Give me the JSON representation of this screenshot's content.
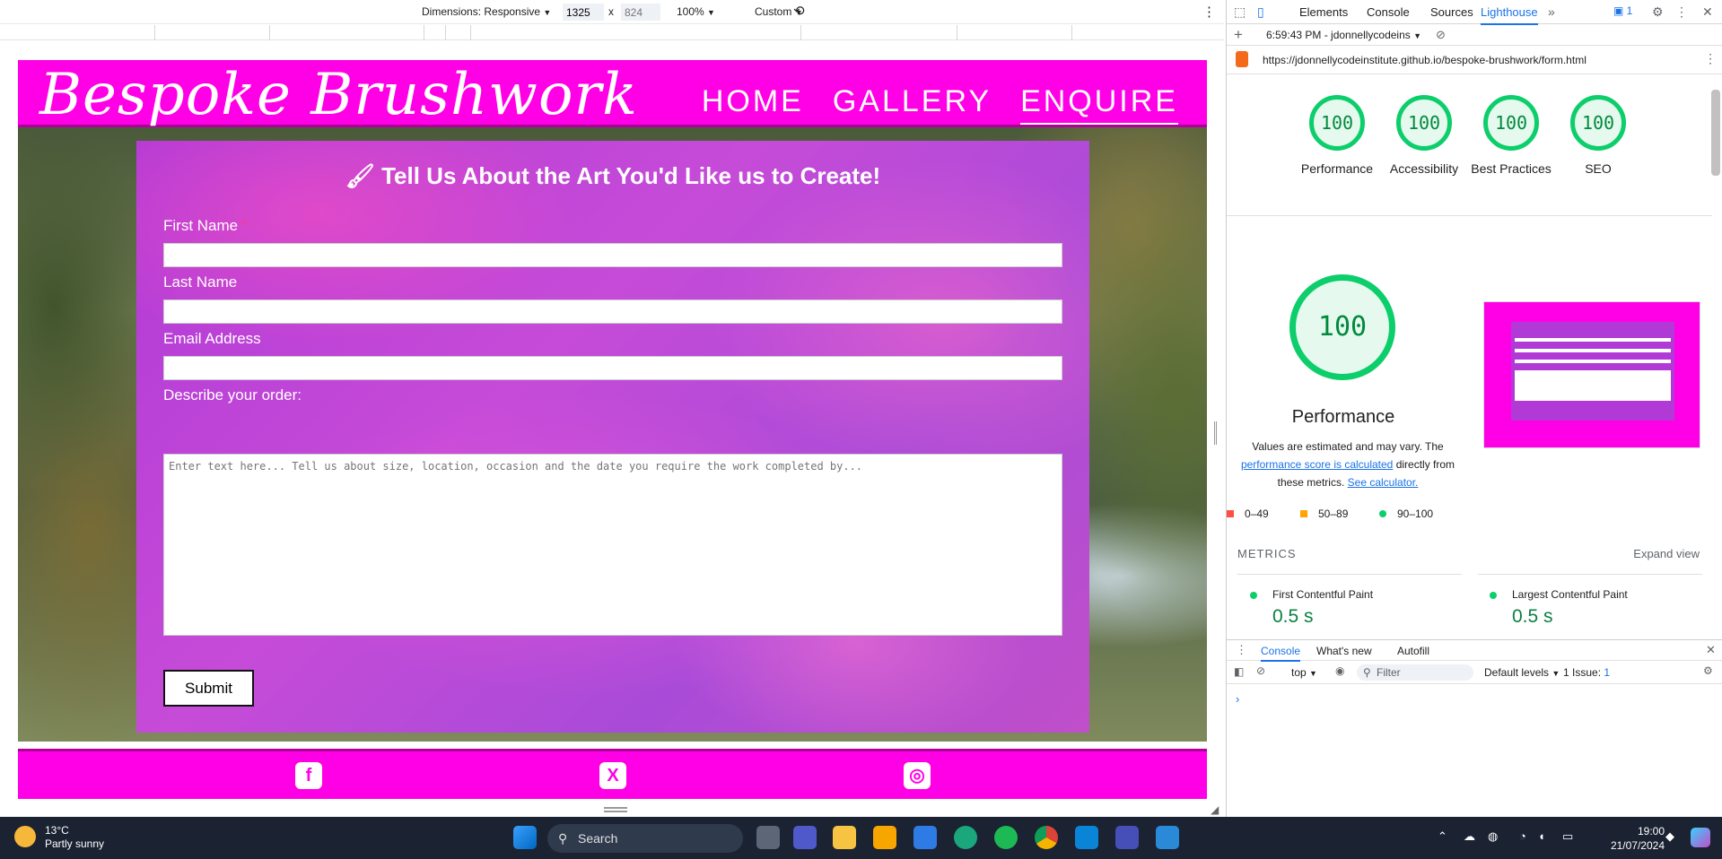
{
  "emulation_toolbar": {
    "dimensions_label": "Dimensions: Responsive",
    "width": "1325",
    "times": "x",
    "height_placeholder": "824",
    "zoom": "100%",
    "throttle": "Custom"
  },
  "site": {
    "logo": "Bespoke Brushwork",
    "nav": [
      "HOME",
      "GALLERY",
      "ENQUIRE"
    ],
    "form": {
      "title": "Tell Us About the Art You'd Like us to Create!",
      "first_name_label": "First Name",
      "first_name_required_marker": "*",
      "last_name_label": "Last Name",
      "email_label": "Email Address",
      "describe_label": "Describe your order:",
      "describe_placeholder": "Enter text here... Tell us about size, location, occasion and the date you require the work completed by...",
      "submit_label": "Submit"
    },
    "footer_icons": [
      "facebook-icon",
      "x-twitter-icon",
      "instagram-icon"
    ]
  },
  "devtools": {
    "tabs": [
      "Elements",
      "Console",
      "Sources",
      "Lighthouse"
    ],
    "active_tab": "Lighthouse",
    "issues_badge": "1",
    "report_time": "6:59:43 PM - jdonnellycodeins",
    "url": "https://jdonnellycodeinstitute.github.io/bespoke-brushwork/form.html",
    "scores": [
      {
        "label": "Performance",
        "value": "100"
      },
      {
        "label": "Accessibility",
        "value": "100"
      },
      {
        "label": "Best Practices",
        "value": "100"
      },
      {
        "label": "SEO",
        "value": "100"
      }
    ],
    "performance": {
      "score": "100",
      "title": "Performance",
      "desc_1": "Values are estimated and may vary. The",
      "desc_link_1": "performance score is calculated",
      "desc_2": "directly from these metrics.",
      "desc_link_2": "See calculator."
    },
    "legend": [
      "0–49",
      "50–89",
      "90–100"
    ],
    "legend_colors": [
      "#ff4e42",
      "#ffa400",
      "#0cce6b"
    ],
    "metrics_heading": "METRICS",
    "expand_view": "Expand view",
    "metrics": [
      {
        "name": "First Contentful Paint",
        "value": "0.5 s"
      },
      {
        "name": "Largest Contentful Paint",
        "value": "0.5 s"
      }
    ],
    "drawer": {
      "tabs": [
        "Console",
        "What's new",
        "Autofill"
      ],
      "context": "top",
      "filter_placeholder": "Filter",
      "levels": "Default levels",
      "issues": "1 Issue:",
      "issues_count": "1",
      "prompt": "›"
    }
  },
  "taskbar": {
    "temperature": "13°C",
    "weather": "Partly sunny",
    "search_placeholder": "Search",
    "time": "19:00",
    "date": "21/07/2024"
  }
}
